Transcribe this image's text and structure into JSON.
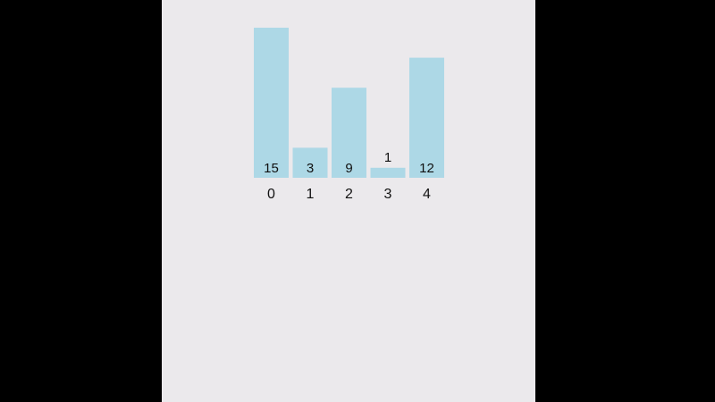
{
  "colors": {
    "background": "#000000",
    "panel": "#ebe9ec",
    "bar": "#add8e6",
    "text": "#111111"
  },
  "chart_data": {
    "type": "bar",
    "categories": [
      "0",
      "1",
      "2",
      "3",
      "4"
    ],
    "values": [
      15,
      3,
      9,
      1,
      12
    ],
    "data_labels": [
      "15",
      "3",
      "9",
      "1",
      "12"
    ],
    "ylim": [
      0,
      15
    ],
    "grid": false,
    "legend": "none"
  }
}
